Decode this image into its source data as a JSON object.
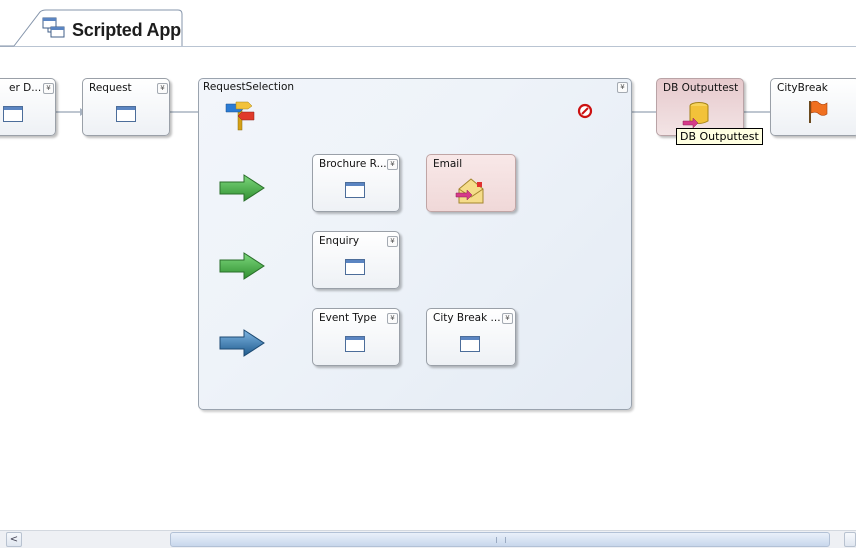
{
  "tab": {
    "title": "Scripted App"
  },
  "nodes": {
    "prev_node_title": "er D...",
    "request_title": "Request",
    "group_title": "RequestSelection",
    "brochure_title": "Brochure R...",
    "email_title": "Email",
    "enquiry_title": "Enquiry",
    "event_type_title": "Event Type",
    "city_break_inner_title": "City Break ...",
    "db_output_title": "DB Outputtest",
    "city_break_title": "CityBreak"
  },
  "tooltip": {
    "text": "DB Outputtest"
  },
  "scrollbar": {
    "left_arrow": "<"
  },
  "colors": {
    "wire": "#a8b3c1",
    "green_arrow": "#3a9a3a",
    "blue_arrow": "#2f6e9e",
    "stop_red": "#cc1111",
    "flag_orange": "#f07020"
  }
}
